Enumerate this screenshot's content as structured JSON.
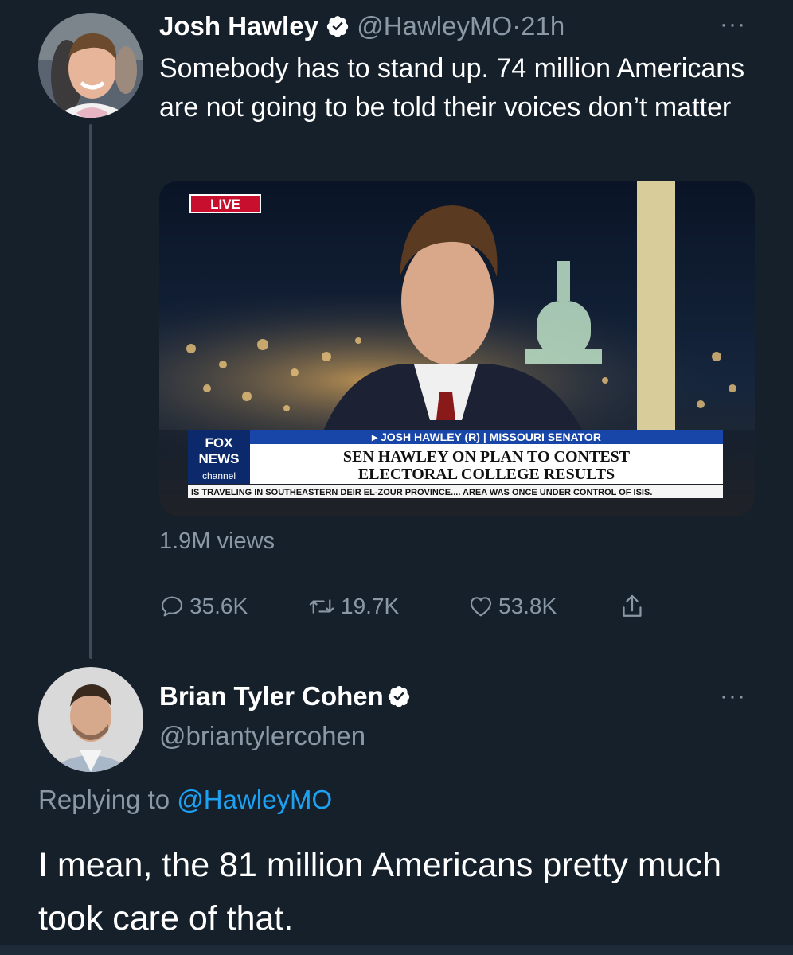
{
  "tweet1": {
    "author_name": "Josh Hawley",
    "handle": "@HawleyMO",
    "separator": "·",
    "time": "21h",
    "more": "···",
    "text": "Somebody has to stand up. 74 million Americans are not going to be told their voices don’t matter",
    "video": {
      "live_badge": "LIVE",
      "network_logo_line1": "FOX",
      "network_logo_line2": "NEWS",
      "network_logo_line3": "channel",
      "lower_third_name": "▸ JOSH HAWLEY (R) | MISSOURI SENATOR",
      "lower_third_headline_line1": "SEN HAWLEY ON PLAN TO CONTEST",
      "lower_third_headline_line2": "ELECTORAL COLLEGE RESULTS",
      "ticker": "IS TRAVELING IN SOUTHEASTERN DEIR EL-ZOUR PROVINCE....  AREA WAS ONCE UNDER CONTROL OF ISIS."
    },
    "views": "1.9M views",
    "actions": {
      "replies": "35.6K",
      "retweets": "19.7K",
      "likes": "53.8K"
    }
  },
  "tweet2": {
    "author_name": "Brian Tyler Cohen",
    "handle": "@briantylercohen",
    "more": "···",
    "replying_prefix": "Replying to",
    "replying_to": "@HawleyMO",
    "text": "I mean, the 81 million Americans pretty much took care of that."
  },
  "colors": {
    "background": "#15202b",
    "text": "#ffffff",
    "muted": "#8b98a5",
    "link": "#1da1f2",
    "verified": "#ffffff"
  }
}
